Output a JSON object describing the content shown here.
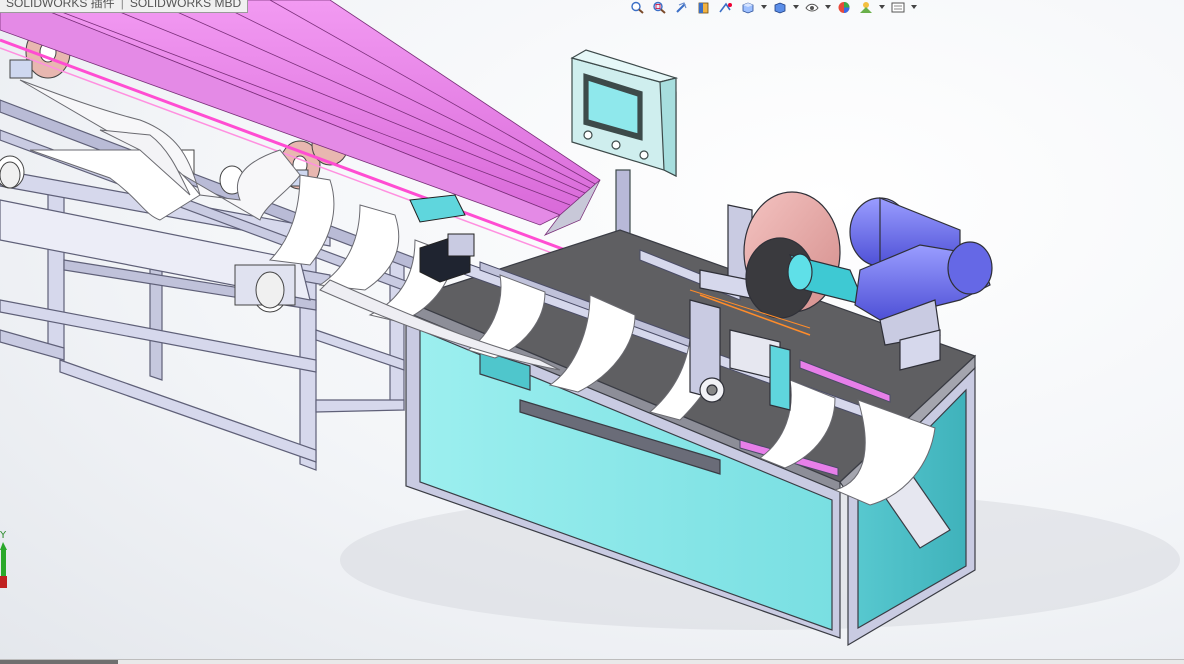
{
  "tabs": {
    "tab1": "SOLIDWORKS 插件",
    "separator": "|",
    "tab2": "SOLIDWORKS MBD"
  },
  "heads_up_toolbar": [
    {
      "id": "zoom-to-fit",
      "icon": "zoom-to-fit-icon"
    },
    {
      "id": "zoom-to-area",
      "icon": "zoom-to-area-icon"
    },
    {
      "id": "previous-view",
      "icon": "previous-view-icon"
    },
    {
      "id": "section-view",
      "icon": "section-view-icon"
    },
    {
      "id": "dynamic-annotation",
      "icon": "dynamic-annotation-view-icon"
    },
    {
      "id": "view-orientation",
      "icon": "view-orientation-icon",
      "dropdown": true
    },
    {
      "id": "display-style",
      "icon": "display-style-icon",
      "dropdown": true
    },
    {
      "id": "hide-show-items",
      "icon": "hide-show-items-icon",
      "dropdown": true
    },
    {
      "id": "edit-appearance",
      "icon": "edit-appearance-icon"
    },
    {
      "id": "apply-scene",
      "icon": "apply-scene-icon",
      "dropdown": true
    },
    {
      "id": "view-settings",
      "icon": "view-settings-icon",
      "dropdown": true
    }
  ],
  "triad": {
    "axis_label": "Y"
  },
  "colors": {
    "machine_cabinet": "#8fe8e8",
    "machine_cabinet_dark": "#4fc6cc",
    "frame": "#c9cbe2",
    "frame_edge": "#5f6078",
    "conveyor_magenta": "#e77fe9",
    "conveyor_line": "#ff4dd2",
    "cutting_blade": "#e9a8a6",
    "motor_blue": "#6f73f0",
    "motor_shaft": "#3ec9d3",
    "paper_strip": "#ffffff",
    "control_box": "#cfeeee",
    "screen": "#8fe8ec",
    "table_top": "#5f5f62"
  }
}
